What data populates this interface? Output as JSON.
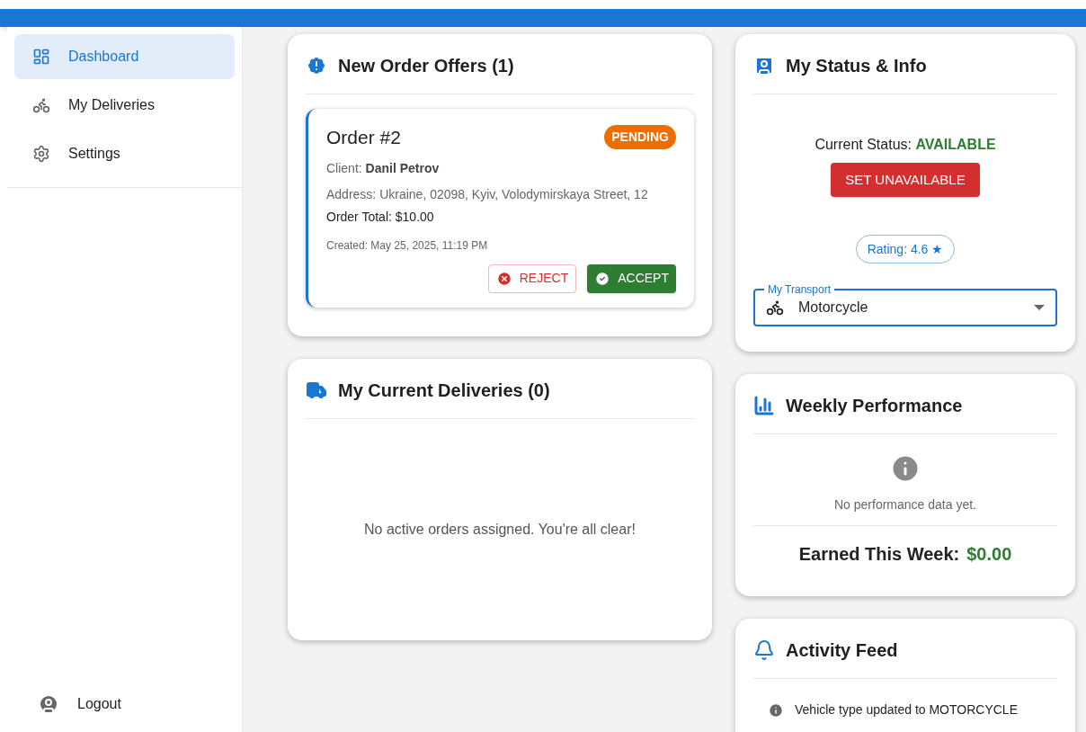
{
  "sidebar": {
    "items": [
      {
        "label": "Dashboard",
        "kind": "dashboard",
        "selected": true
      },
      {
        "label": "My Deliveries",
        "kind": "deliveries",
        "selected": false
      },
      {
        "label": "Settings",
        "kind": "settings",
        "selected": false
      }
    ],
    "logout": "Logout"
  },
  "offers": {
    "title": "New Order Offers (1)",
    "orders": [
      {
        "title": "Order #2",
        "status": "PENDING",
        "client": "Client: **Danil Petrov**",
        "address": "Address: Ukraine, 02098, Kyiv, Volodymirskaya Street, 12",
        "total": "Order Total: $10.00",
        "created": "Created: May 25, 2025, 11:19 PM",
        "reject": "REJECT",
        "accept": "ACCEPT"
      }
    ]
  },
  "current": {
    "title": "My Current Deliveries (0)",
    "empty": "No active orders assigned. You're all clear!"
  },
  "status": {
    "title": "My Status & Info",
    "status_label": "Current Status:",
    "status_value": "AVAILABLE",
    "available": true,
    "toggle": "SET UNAVAILABLE",
    "rating": "Rating: 4.6 ★",
    "transport_label": "My Transport",
    "transport_value": "Motorcycle"
  },
  "performance": {
    "title": "Weekly Performance",
    "empty": "No performance data yet.",
    "earned_label": "Earned This Week:",
    "earned_value": "$0.00"
  },
  "activity": {
    "title": "Activity Feed",
    "items": [
      "Vehicle type updated to MOTORCYCLE"
    ]
  }
}
